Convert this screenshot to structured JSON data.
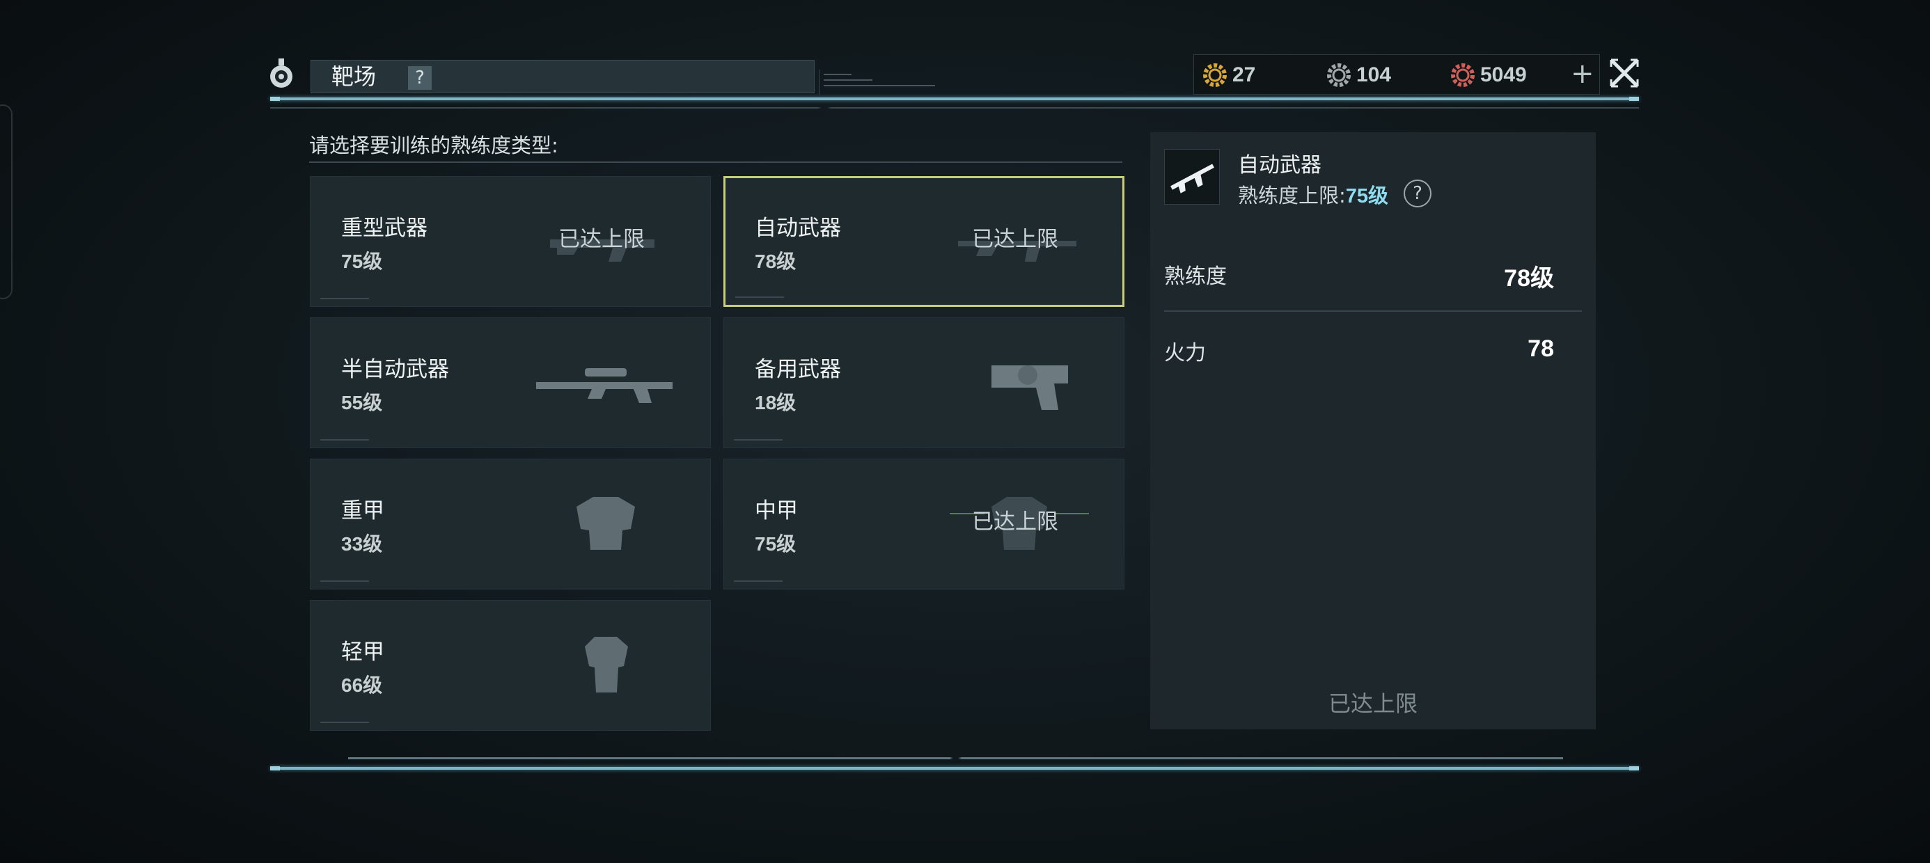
{
  "header": {
    "title": "靶场",
    "help_label": "?",
    "close_label": "close"
  },
  "currencies": [
    {
      "name": "gold-gear",
      "amount": "27",
      "color": "#d8a73a"
    },
    {
      "name": "silver-gear",
      "amount": "104",
      "color": "#a3a8aa"
    },
    {
      "name": "red-gear",
      "amount": "5049",
      "color": "#d0605a"
    }
  ],
  "currency_add_label": "+",
  "section": {
    "title": "请选择要训练的熟练度类型:"
  },
  "categories": [
    {
      "name": "重型武器",
      "level": "75级",
      "maxed_label": "已达上限",
      "icon": "heavy-weapon-icon",
      "selected": false
    },
    {
      "name": "自动武器",
      "level": "78级",
      "maxed_label": "已达上限",
      "icon": "assault-rifle-icon",
      "selected": true
    },
    {
      "name": "半自动武器",
      "level": "55级",
      "maxed_label": "",
      "icon": "sniper-rifle-icon",
      "selected": false
    },
    {
      "name": "备用武器",
      "level": "18级",
      "maxed_label": "",
      "icon": "pistol-icon",
      "selected": false
    },
    {
      "name": "重甲",
      "level": "33级",
      "maxed_label": "",
      "icon": "heavy-armor-icon",
      "selected": false
    },
    {
      "name": "中甲",
      "level": "75级",
      "maxed_label": "已达上限",
      "icon": "medium-armor-icon",
      "selected": false
    },
    {
      "name": "轻甲",
      "level": "66级",
      "maxed_label": "",
      "icon": "light-armor-icon",
      "selected": false
    }
  ],
  "detail": {
    "name": "自动武器",
    "cap_label": "熟练度上限:",
    "cap_value": "75级",
    "help_label": "?",
    "stats": [
      {
        "label": "熟练度",
        "value": "78级"
      },
      {
        "label": "火力",
        "value": "78"
      }
    ],
    "footer": "已达上限"
  },
  "colors": {
    "accent_frame": "#7fb4c4",
    "selected_border": "#c6cf78",
    "cap_value": "#8fdcf0"
  }
}
